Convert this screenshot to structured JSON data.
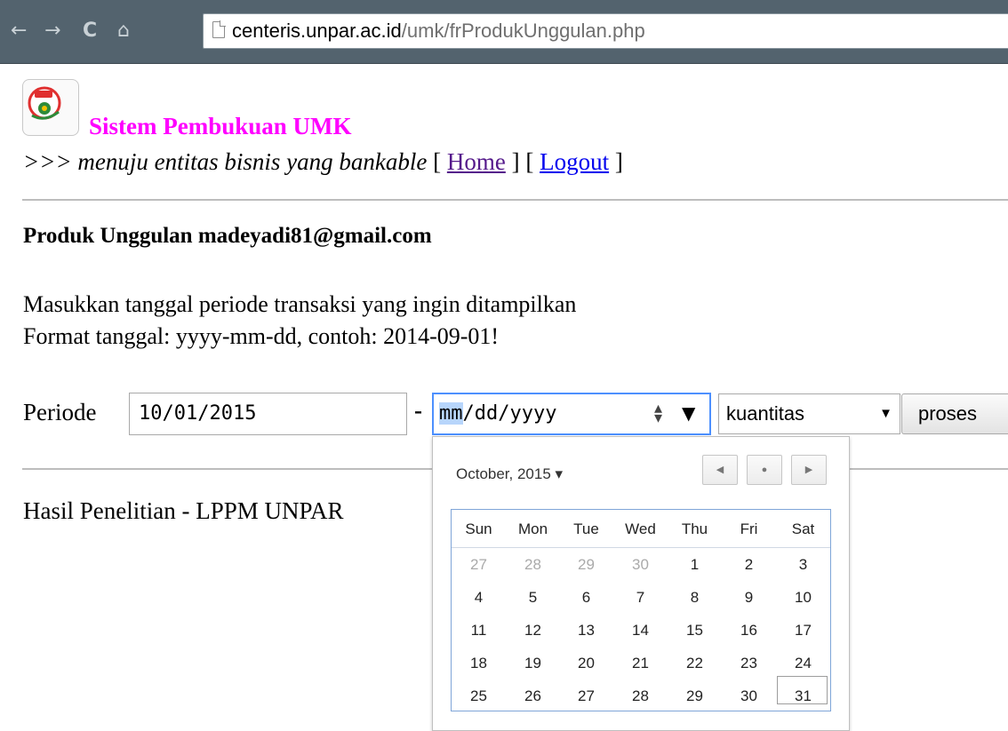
{
  "browser": {
    "url_host": "centeris.unpar.ac.id",
    "url_path": "/umk/frProdukUnggulan.php",
    "back_glyph": "←",
    "forward_glyph": "→",
    "reload_glyph": "C",
    "home_glyph": "⌂"
  },
  "header": {
    "app_title": "Sistem Pembukuan UMK",
    "tagline": ">>> menuju entitas bisnis yang bankable",
    "bracket_open": "[",
    "bracket_close": "]",
    "home_link": "Home",
    "logout_link": "Logout"
  },
  "main": {
    "heading": "Produk Unggulan madeyadi81@gmail.com",
    "instruction_line1": "Masukkan tanggal periode transaksi yang ingin ditampilkan",
    "instruction_line2": "Format tanggal: yyyy-mm-dd, contoh: 2014-09-01!",
    "periode_label": "Periode",
    "from_date_value": "10/01/2015",
    "dash": "-",
    "to_date_mm": "mm",
    "to_date_rest": "/dd/yyyy",
    "select_value": "kuantitas",
    "submit_label": "proses",
    "footer": "Hasil Penelitian - LPPM UNPAR"
  },
  "datepicker": {
    "month_label": "October, 2015 ▾",
    "prev_glyph": "◀",
    "today_glyph": "●",
    "next_glyph": "▶",
    "weekdays": [
      "Sun",
      "Mon",
      "Tue",
      "Wed",
      "Thu",
      "Fri",
      "Sat"
    ],
    "weeks": [
      [
        "27",
        "28",
        "29",
        "30",
        "1",
        "2",
        "3"
      ],
      [
        "4",
        "5",
        "6",
        "7",
        "8",
        "9",
        "10"
      ],
      [
        "11",
        "12",
        "13",
        "14",
        "15",
        "16",
        "17"
      ],
      [
        "18",
        "19",
        "20",
        "21",
        "22",
        "23",
        "24"
      ],
      [
        "25",
        "26",
        "27",
        "28",
        "29",
        "30",
        "31"
      ]
    ],
    "outside_month_first_row_count": 4,
    "highlighted_day": "31"
  },
  "colors": {
    "toolbar": "#53636e",
    "title_magenta": "#ff00ff",
    "focus_blue": "#4d90fe"
  }
}
